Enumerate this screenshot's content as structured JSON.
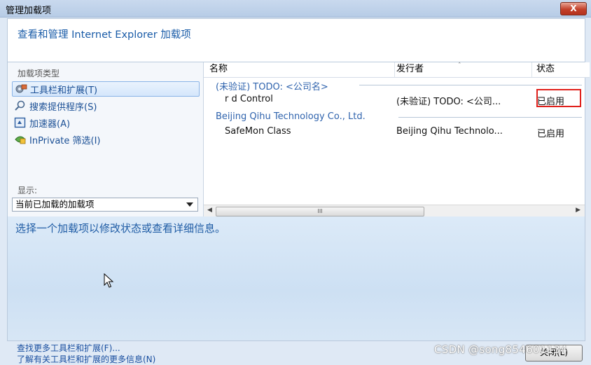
{
  "window": {
    "title": "管理加载项",
    "close_label": "X"
  },
  "header": {
    "heading": "查看和管理 Internet Explorer 加载项"
  },
  "sidebar": {
    "section_label": "加载项类型",
    "items": [
      {
        "label": "工具栏和扩展(T)",
        "icon": "gear-icon",
        "selected": true
      },
      {
        "label": "搜索提供程序(S)",
        "icon": "search-icon",
        "selected": false
      },
      {
        "label": "加速器(A)",
        "icon": "accelerator-icon",
        "selected": false
      },
      {
        "label": "InPrivate 筛选(I)",
        "icon": "inprivate-icon",
        "selected": false
      }
    ],
    "show_label": "显示:",
    "show_selected": "当前已加载的加载项"
  },
  "list": {
    "columns": [
      "名称",
      "发行者",
      "状态"
    ],
    "groups": [
      {
        "header": "(未验证) TODO: <公司名>",
        "rows": [
          {
            "name": "r    d Control",
            "publisher": "(未验证) TODO: <公司...",
            "status": "已启用"
          }
        ]
      },
      {
        "header": "Beijing Qihu Technology Co., Ltd.",
        "rows": [
          {
            "name": "SafeMon Class",
            "publisher": "Beijing Qihu Technolo...",
            "status": "已启用"
          }
        ]
      }
    ],
    "scroll_thumb_label": "III"
  },
  "detail": {
    "message": "选择一个加载项以修改状态或查看详细信息。"
  },
  "footer": {
    "link_find_more": "查找更多工具栏和扩展(F)...",
    "link_learn_more": "了解有关工具栏和扩展的更多信息(N)",
    "close_button": "关闭(L)",
    "watermark": "CSDN @song854601134"
  }
}
